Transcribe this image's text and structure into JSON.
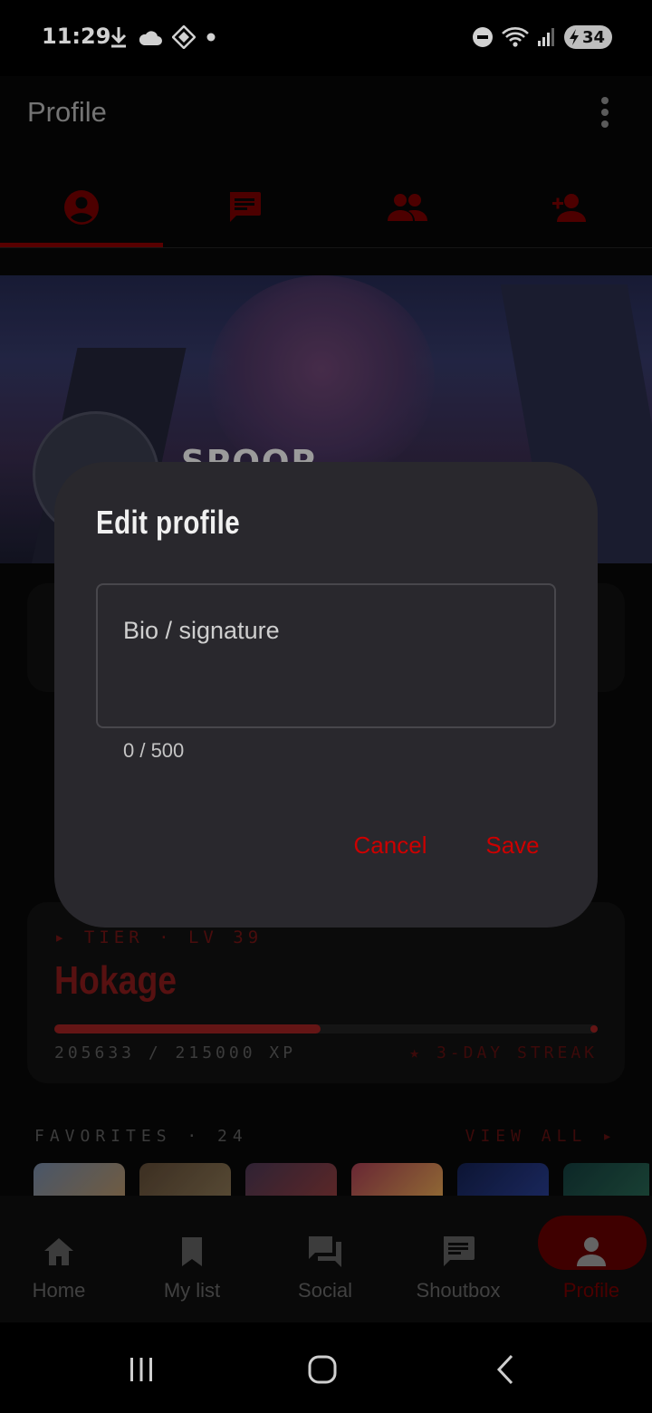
{
  "status_bar": {
    "time": "11:29",
    "battery": "34",
    "icons": [
      "download-icon",
      "cloud-icon",
      "app-icon",
      "dot-icon",
      "dnd-icon",
      "wifi-icon",
      "signal-icon",
      "battery-icon"
    ]
  },
  "app_bar": {
    "title": "Profile"
  },
  "tabs": [
    {
      "icon": "account-circle-icon",
      "active": true
    },
    {
      "icon": "message-icon",
      "active": false
    },
    {
      "icon": "group-icon",
      "active": false
    },
    {
      "icon": "person-add-icon",
      "active": false
    }
  ],
  "banner": {
    "username_partial": "SPOOP"
  },
  "tier": {
    "label": "▸ TIER · LV 39",
    "name": "Hokage",
    "xp_text": "205633 / 215000 XP",
    "xp_current": 205633,
    "xp_target": 215000,
    "streak": "★ 3-DAY STREAK"
  },
  "favorites": {
    "header": "FAVORITES · 24",
    "view_all": "VIEW ALL ▸"
  },
  "bottom_nav": [
    {
      "label": "Home",
      "icon": "home-icon",
      "active": false
    },
    {
      "label": "My list",
      "icon": "bookmark-icon",
      "active": false
    },
    {
      "label": "Social",
      "icon": "forum-icon",
      "active": false
    },
    {
      "label": "Shoutbox",
      "icon": "chat-icon",
      "active": false
    },
    {
      "label": "Profile",
      "icon": "person-icon",
      "active": true
    }
  ],
  "dialog": {
    "title": "Edit profile",
    "bio_placeholder": "Bio / signature",
    "bio_value": "",
    "char_count": "0 / 500",
    "cancel_label": "Cancel",
    "save_label": "Save"
  },
  "colors": {
    "accent": "#cc0000",
    "dialog_bg": "#29282d",
    "background": "#060606"
  }
}
